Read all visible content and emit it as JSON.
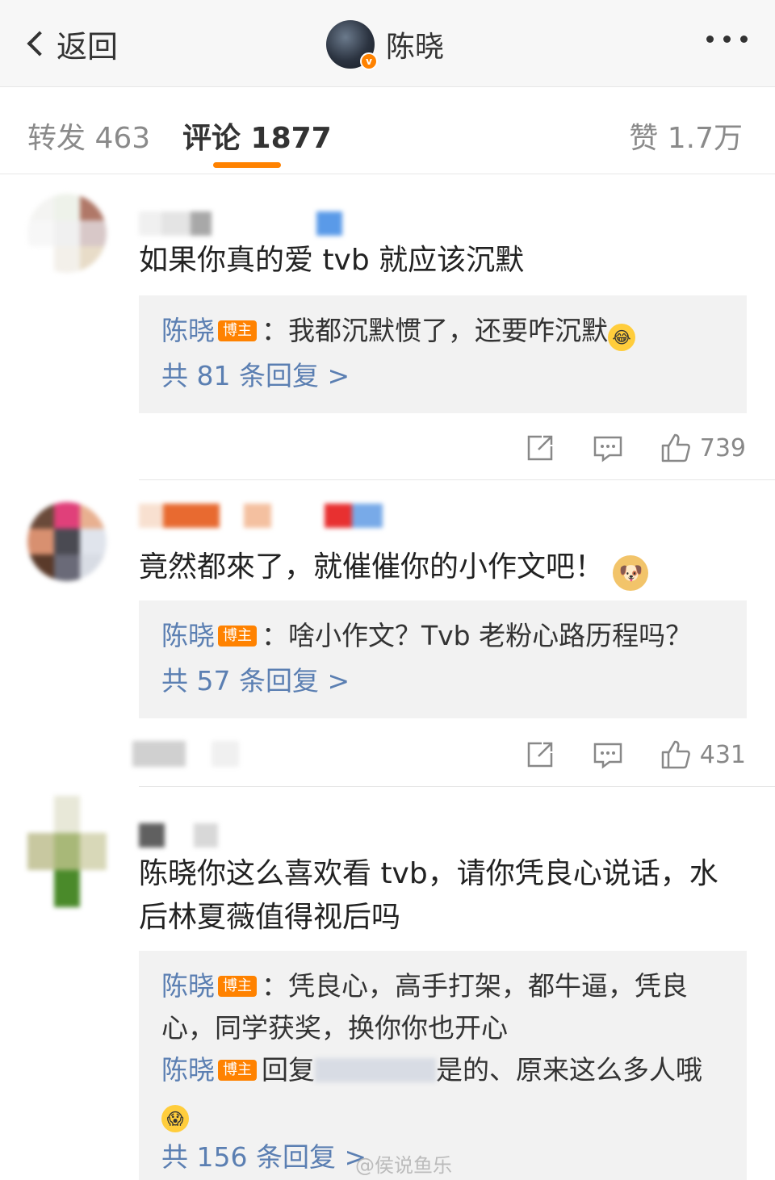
{
  "nav": {
    "back_label": "返回",
    "user_name": "陈晓",
    "verified_badge": "v"
  },
  "tabs": {
    "repost": "转发 463",
    "comment": "评论 1877",
    "like": "赞 1.7万"
  },
  "comments": [
    {
      "text": "如果你真的爱 tvb 就应该沉默",
      "reply_author": "陈晓",
      "reply_badge": "博主",
      "reply_text": "：我都沉默惯了，还要咋沉默",
      "more_replies": "共 81 条回复 >",
      "likes": "739"
    },
    {
      "text": "竟然都來了，就催催你的小作文吧！",
      "reply_author": "陈晓",
      "reply_badge": "博主",
      "reply_text": "：啥小作文？Tvb 老粉心路历程吗？",
      "more_replies": "共 57 条回复 >",
      "likes": "431"
    },
    {
      "text": "陈晓你这么喜欢看 tvb，请你凭良心说话，水后林夏薇值得视后吗",
      "reply_author": "陈晓",
      "reply_badge": "博主",
      "reply_text": "：凭良心，高手打架，都牛逼，凭良心，同学获奖，换你你也开心",
      "reply2_author": "陈晓",
      "reply2_badge": "博主",
      "reply2_prefix": "回复",
      "reply2_text": "是的、原来这么多人哦",
      "more_replies": "共 156 条回复 >"
    }
  ],
  "watermark": "@侯说鱼乐",
  "colors": {
    "accent": "#ff8200",
    "link": "#5b7fb2",
    "reply_bg": "#f2f2f2"
  }
}
